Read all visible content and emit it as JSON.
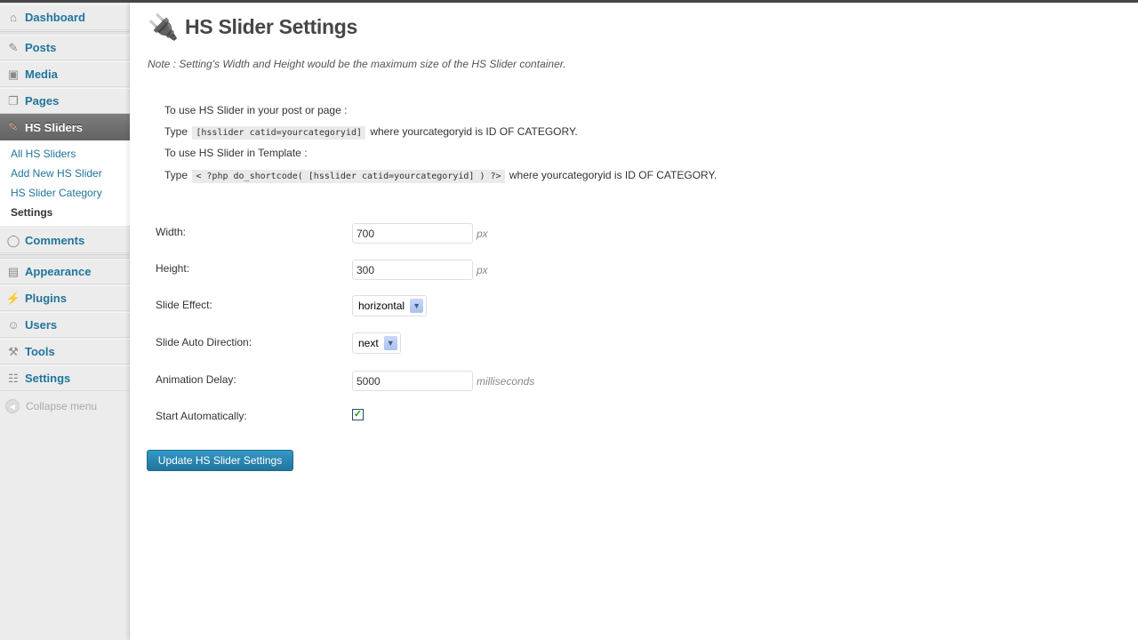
{
  "sidebar": {
    "items": [
      {
        "label": "Dashboard",
        "icon": "home-icon"
      },
      {
        "label": "Posts",
        "icon": "pin-icon"
      },
      {
        "label": "Media",
        "icon": "media-icon"
      },
      {
        "label": "Pages",
        "icon": "pages-icon"
      },
      {
        "label": "HS Sliders",
        "icon": "pin-icon"
      },
      {
        "label": "Comments",
        "icon": "comment-icon"
      },
      {
        "label": "Appearance",
        "icon": "appearance-icon"
      },
      {
        "label": "Plugins",
        "icon": "plug-icon"
      },
      {
        "label": "Users",
        "icon": "users-icon"
      },
      {
        "label": "Tools",
        "icon": "tools-icon"
      },
      {
        "label": "Settings",
        "icon": "settings-icon"
      }
    ],
    "submenu": [
      "All HS Sliders",
      "Add New HS Slider",
      "HS Slider Category",
      "Settings"
    ],
    "collapse_label": "Collapse menu"
  },
  "page": {
    "title": "HS Slider Settings",
    "note": "Note : Setting's Width and Height would be the maximum size of the HS Slider container.",
    "instructions": {
      "post_heading": "To use HS Slider in your post or page :",
      "type_label": "Type",
      "post_code": "[hsslider catid=yourcategoryid]",
      "post_suffix": "where yourcategoryid is ID OF CATEGORY.",
      "template_heading": "To use HS Slider in Template :",
      "template_code": "< ?php do_shortcode( [hsslider catid=yourcategoryid] ) ?>",
      "template_suffix": "where yourcategoryid is ID OF CATEGORY."
    }
  },
  "form": {
    "width": {
      "label": "Width:",
      "value": "700",
      "unit": "px"
    },
    "height": {
      "label": "Height:",
      "value": "300",
      "unit": "px"
    },
    "effect": {
      "label": "Slide Effect:",
      "value": "horizontal"
    },
    "direction": {
      "label": "Slide Auto Direction:",
      "value": "next"
    },
    "delay": {
      "label": "Animation Delay:",
      "value": "5000",
      "unit": "milliseconds"
    },
    "auto": {
      "label": "Start Automatically:",
      "checked": true
    },
    "submit_label": "Update HS Slider Settings"
  },
  "colors": {
    "accent": "#21759b",
    "active_menu": "#6d6d6d",
    "button": "#2e8bbb"
  }
}
